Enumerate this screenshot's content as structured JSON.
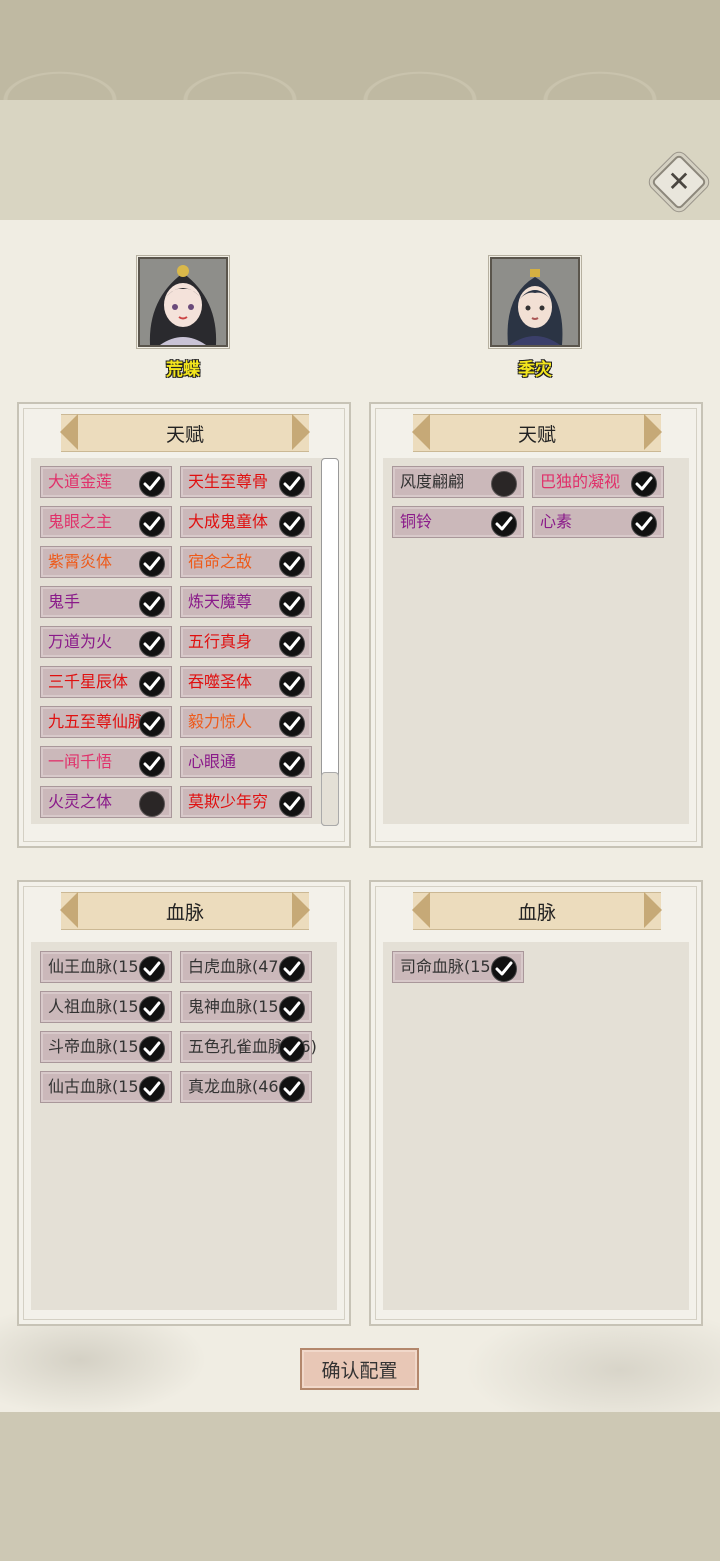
{
  "characters": [
    {
      "name": "荒蝶"
    },
    {
      "name": "季灾"
    }
  ],
  "left": {
    "talent_title": "天赋",
    "talents": [
      {
        "label": "大道金莲",
        "color": "#e0306a",
        "checked": true
      },
      {
        "label": "天生至尊骨",
        "color": "#e01010",
        "checked": true
      },
      {
        "label": "鬼眼之主",
        "color": "#e0306a",
        "checked": true
      },
      {
        "label": "大成鬼童体",
        "color": "#e01010",
        "checked": true
      },
      {
        "label": "紫霄炎体",
        "color": "#ee5a1a",
        "checked": true
      },
      {
        "label": "宿命之敌",
        "color": "#ee5a1a",
        "checked": true
      },
      {
        "label": "鬼手",
        "color": "#8a1a8a",
        "checked": true
      },
      {
        "label": "炼天魔尊",
        "color": "#8a1a8a",
        "checked": true
      },
      {
        "label": "万道为火",
        "color": "#8a1a8a",
        "checked": true
      },
      {
        "label": "五行真身",
        "color": "#e01010",
        "checked": true
      },
      {
        "label": "三千星辰体",
        "color": "#e01010",
        "checked": true
      },
      {
        "label": "吞噬圣体",
        "color": "#e01010",
        "checked": true
      },
      {
        "label": "九五至尊仙脉",
        "color": "#e01010",
        "checked": true
      },
      {
        "label": "毅力惊人",
        "color": "#ee5a1a",
        "checked": true
      },
      {
        "label": "一闻千悟",
        "color": "#e0306a",
        "checked": true
      },
      {
        "label": "心眼通",
        "color": "#8a1a8a",
        "checked": true
      },
      {
        "label": "火灵之体",
        "color": "#8a1a8a",
        "checked": false
      },
      {
        "label": "莫欺少年穷",
        "color": "#e01010",
        "checked": true
      }
    ],
    "bloodline_title": "血脉",
    "bloodlines": [
      {
        "label": "仙王血脉(15",
        "checked": true
      },
      {
        "label": "白虎血脉(47",
        "checked": true
      },
      {
        "label": "人祖血脉(15",
        "checked": true
      },
      {
        "label": "鬼神血脉(15",
        "checked": true
      },
      {
        "label": "斗帝血脉(15",
        "checked": true
      },
      {
        "label": "五色孔雀血脉(46)",
        "checked": true
      },
      {
        "label": "仙古血脉(15",
        "checked": true
      },
      {
        "label": "真龙血脉(46",
        "checked": true
      }
    ]
  },
  "right": {
    "talent_title": "天赋",
    "talents": [
      {
        "label": "风度翩翩",
        "color": "#333333",
        "checked": false
      },
      {
        "label": "巴独的凝视",
        "color": "#e0306a",
        "checked": true
      },
      {
        "label": "铜铃",
        "color": "#8a1a8a",
        "checked": true
      },
      {
        "label": "心素",
        "color": "#8a1a8a",
        "checked": true
      }
    ],
    "bloodline_title": "血脉",
    "bloodlines": [
      {
        "label": "司命血脉(15",
        "checked": true
      }
    ]
  },
  "confirm_label": "确认配置",
  "colors": {
    "item_bg": "#cbb8ba",
    "ribbon_bg": "#ecdcbd",
    "name_color": "#f3e61d",
    "confirm_bg": "#e8c7b6"
  }
}
